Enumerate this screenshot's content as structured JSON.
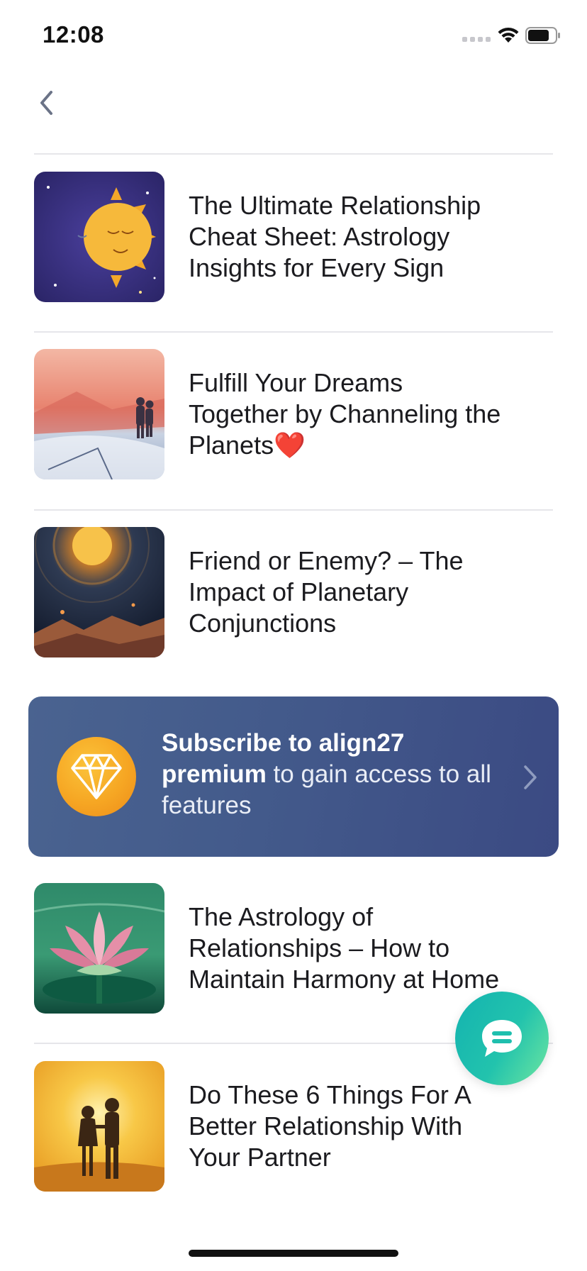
{
  "status_bar": {
    "time": "12:08",
    "signal_icon": "cellular-signal-icon",
    "wifi_icon": "wifi-icon",
    "battery_icon": "battery-icon"
  },
  "nav": {
    "back_icon": "chevron-left-icon"
  },
  "articles_top": [
    {
      "title_lines": [
        "The Ultimate Relationship",
        "Cheat Sheet: Astrology",
        "Insights for Every Sign"
      ],
      "thumb": "sun-moon-illustration"
    },
    {
      "title_lines": [
        "Fulfill Your Dreams",
        "Together by Channeling the",
        "Planets❤️"
      ],
      "thumb": "couple-landscape-illustration"
    },
    {
      "title_lines": [
        "Friend or Enemy? – The",
        "Impact of Planetary",
        "Conjunctions"
      ],
      "thumb": "planet-sky-illustration"
    }
  ],
  "premium_banner": {
    "bold_text": "Subscribe to align27 premium",
    "rest_text": " to gain access to all features",
    "icon": "diamond-icon",
    "chevron": "chevron-right-icon",
    "colors": {
      "banner": "#435a8b",
      "gem": "#f6a623"
    }
  },
  "articles_bottom": [
    {
      "title_lines": [
        "The Astrology of",
        "Relationships – How to",
        "Maintain Harmony at Home"
      ],
      "thumb": "lotus-illustration"
    },
    {
      "title_lines": [
        "Do These 6 Things For A",
        "Better Relationship With",
        "Your Partner"
      ],
      "thumb": "couple-sunset-illustration"
    }
  ],
  "chat_fab": {
    "icon": "chat-bubble-icon",
    "color": "#1fbfae"
  }
}
